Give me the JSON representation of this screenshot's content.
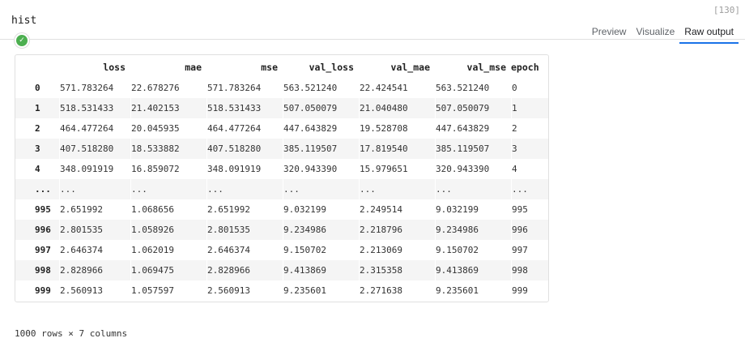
{
  "cell": {
    "code": "hist",
    "execution_count": "[130]"
  },
  "status": {
    "icon": "check-icon",
    "color": "#4caf50"
  },
  "tabs": [
    {
      "label": "Preview",
      "active": false
    },
    {
      "label": "Visualize",
      "active": false
    },
    {
      "label": "Raw output",
      "active": true
    }
  ],
  "table": {
    "columns": [
      "",
      "loss",
      "mae",
      "mse",
      "val_loss",
      "val_mae",
      "val_mse",
      "epoch"
    ],
    "rows": [
      [
        "0",
        "571.783264",
        "22.678276",
        "571.783264",
        "563.521240",
        "22.424541",
        "563.521240",
        "0"
      ],
      [
        "1",
        "518.531433",
        "21.402153",
        "518.531433",
        "507.050079",
        "21.040480",
        "507.050079",
        "1"
      ],
      [
        "2",
        "464.477264",
        "20.045935",
        "464.477264",
        "447.643829",
        "19.528708",
        "447.643829",
        "2"
      ],
      [
        "3",
        "407.518280",
        "18.533882",
        "407.518280",
        "385.119507",
        "17.819540",
        "385.119507",
        "3"
      ],
      [
        "4",
        "348.091919",
        "16.859072",
        "348.091919",
        "320.943390",
        "15.979651",
        "320.943390",
        "4"
      ],
      [
        "...",
        "...",
        "...",
        "...",
        "...",
        "...",
        "...",
        "..."
      ],
      [
        "995",
        "2.651992",
        "1.068656",
        "2.651992",
        "9.032199",
        "2.249514",
        "9.032199",
        "995"
      ],
      [
        "996",
        "2.801535",
        "1.058926",
        "2.801535",
        "9.234986",
        "2.218796",
        "9.234986",
        "996"
      ],
      [
        "997",
        "2.646374",
        "1.062019",
        "2.646374",
        "9.150702",
        "2.213069",
        "9.150702",
        "997"
      ],
      [
        "998",
        "2.828966",
        "1.069475",
        "2.828966",
        "9.413869",
        "2.315358",
        "9.413869",
        "998"
      ],
      [
        "999",
        "2.560913",
        "1.057597",
        "2.560913",
        "9.235601",
        "2.271638",
        "9.235601",
        "999"
      ]
    ],
    "shape_note": "1000 rows × 7 columns"
  }
}
